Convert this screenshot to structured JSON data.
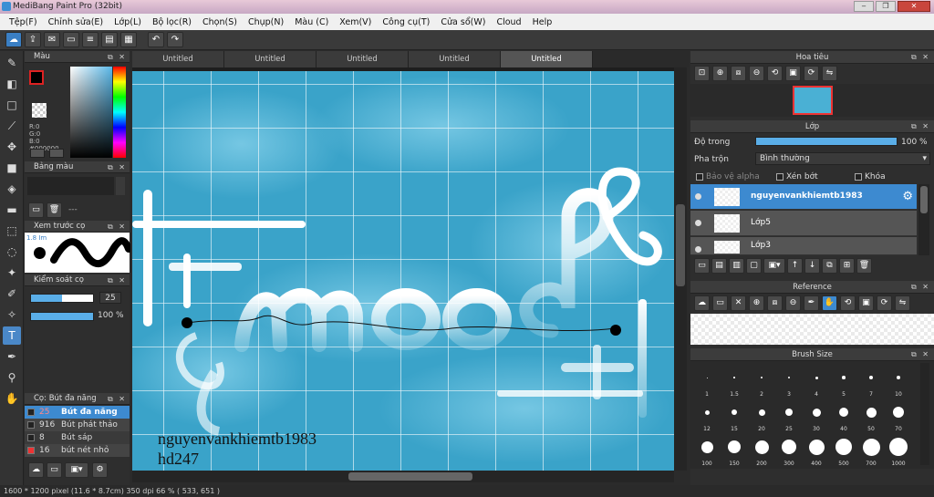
{
  "window": {
    "title": "MediBang Paint Pro (32bit)"
  },
  "menu": [
    "Tệp(F)",
    "Chỉnh sửa(E)",
    "Lớp(L)",
    "Bộ lọc(R)",
    "Chọn(S)",
    "Chụp(N)",
    "Màu (C)",
    "Xem(V)",
    "Công cụ(T)",
    "Cửa sổ(W)",
    "Cloud",
    "Help"
  ],
  "tabs": [
    "Untitled",
    "Untitled",
    "Untitled",
    "Untitled",
    "Untitled"
  ],
  "panels": {
    "color": {
      "title": "Màu",
      "r": "R:0",
      "g": "G:0",
      "b": "B:0",
      "hex": "#000000"
    },
    "palette": {
      "title": "Bảng màu",
      "dash": "---"
    },
    "brush_preview": {
      "title": "Xem trước cọ",
      "size_label": "1.8 Im"
    },
    "brush_control": {
      "title": "Kiểm soát cọ",
      "size": "25",
      "opacity": "100 %"
    },
    "brush_list": {
      "title": "Cọ: Bút đa năng",
      "items": [
        {
          "size": "25",
          "name": "Bút đa năng"
        },
        {
          "size": "916",
          "name": "Bút phát thảo"
        },
        {
          "size": "8",
          "name": "Bút sáp"
        },
        {
          "size": "16",
          "name": "bút nét nhỏ"
        }
      ]
    },
    "navigator": {
      "title": "Hoa tiêu"
    },
    "layer": {
      "title": "Lớp",
      "opacity_label": "Độ trong",
      "opacity_value": "100 %",
      "blend_label": "Pha trộn",
      "blend_value": "Bình thường",
      "protect_alpha": "Bảo vệ alpha",
      "clipping": "Xén bớt",
      "lock": "Khóa",
      "layers": [
        "nguyenvankhiemtb1983",
        "Lớp5",
        "Lớp3"
      ]
    },
    "reference": {
      "title": "Reference"
    },
    "brush_size": {
      "title": "Brush Size",
      "sizes": [
        "1",
        "1.5",
        "2",
        "3",
        "4",
        "5",
        "7",
        "10",
        "12",
        "15",
        "20",
        "25",
        "30",
        "40",
        "50",
        "70",
        "100",
        "150",
        "200",
        "300",
        "400",
        "500",
        "700",
        "1000"
      ]
    }
  },
  "canvas_text": {
    "line1": "nguyenvankhiemtb1983",
    "line2": "hd247"
  },
  "status": "1600 * 1200 pixel  (11.6 * 8.7cm)  350 dpi  66 %  ( 533, 651 )",
  "colors": {
    "accent": "#3d8ad0",
    "canvas": "#3aa3c9",
    "close": "#c9463d"
  }
}
